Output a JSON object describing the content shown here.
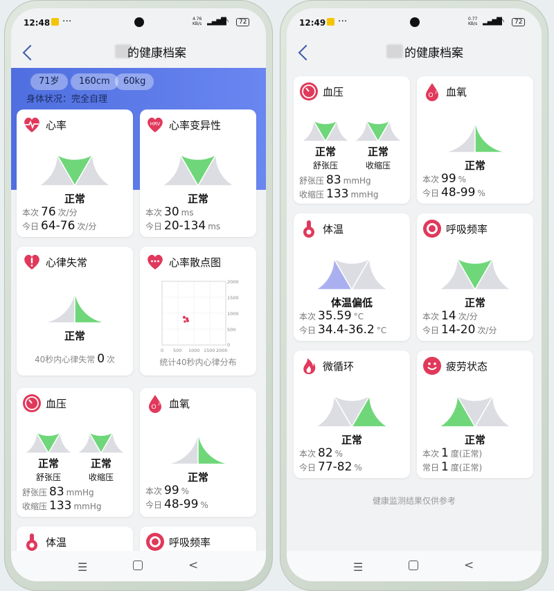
{
  "status": {
    "time_left": "12:48",
    "time_right": "12:49",
    "net_left": "4.76 KB/s",
    "net_right": "0.77 KB/s",
    "battery": "72"
  },
  "header": {
    "title_suffix": "的健康档案"
  },
  "profile": {
    "age": "71岁",
    "height": "160cm",
    "weight": "60kg",
    "condition": "身体状况：完全自理"
  },
  "labels": {
    "now": "本次",
    "today": "今日",
    "today_alt": "常日",
    "normal": "正常",
    "diastolic_name": "舒张压",
    "systolic_name": "收缩压",
    "unit_bpm": "次/分",
    "unit_ms": "ms",
    "unit_mmhg": "mmHg",
    "unit_pct": "%",
    "unit_c": "°C",
    "unit_deg_normal": "度(正常)"
  },
  "heart_rate": {
    "title": "心率",
    "status": "正常",
    "now": "76",
    "today": "64-76"
  },
  "hrv": {
    "title": "心率变异性",
    "status": "正常",
    "now": "30",
    "today": "20-134",
    "icon_text": "HRV"
  },
  "arrhythmia": {
    "title": "心律失常",
    "status": "正常",
    "note": "40秒内心律失常",
    "count": "0",
    "unit": "次"
  },
  "scatter": {
    "title": "心率散点图",
    "caption": "统计40秒内心律分布",
    "ticks_y": [
      "2000",
      "1500",
      "1000",
      "500",
      "0"
    ],
    "ticks_x": [
      "0",
      "500",
      "1000",
      "1500",
      "2000"
    ]
  },
  "blood_pressure": {
    "title": "血压",
    "status_dia": "正常",
    "status_sys": "正常",
    "dia": "83",
    "sys": "133",
    "dia_label": "舒张压",
    "sys_label": "收缩压"
  },
  "spo2": {
    "title": "血氧",
    "status": "正常",
    "now": "99",
    "today": "48-99"
  },
  "temperature": {
    "title": "体温",
    "status": "体温偏低",
    "now": "35.59",
    "today": "34.4-36.2"
  },
  "respiration": {
    "title": "呼吸频率",
    "status": "正常",
    "now": "14",
    "today": "14-20"
  },
  "microcirc": {
    "title": "微循环",
    "status": "正常",
    "now": "82",
    "today": "77-82"
  },
  "fatigue": {
    "title": "疲劳状态",
    "status": "正常",
    "now": "1",
    "today": "1"
  },
  "footer": {
    "note": "健康监测结果仅供参考"
  },
  "colors": {
    "green": "#6fd77a",
    "gray": "#dcdde2",
    "blue": "#aab0ef",
    "accent": "#e0395b",
    "banner": "#5a79e8"
  }
}
